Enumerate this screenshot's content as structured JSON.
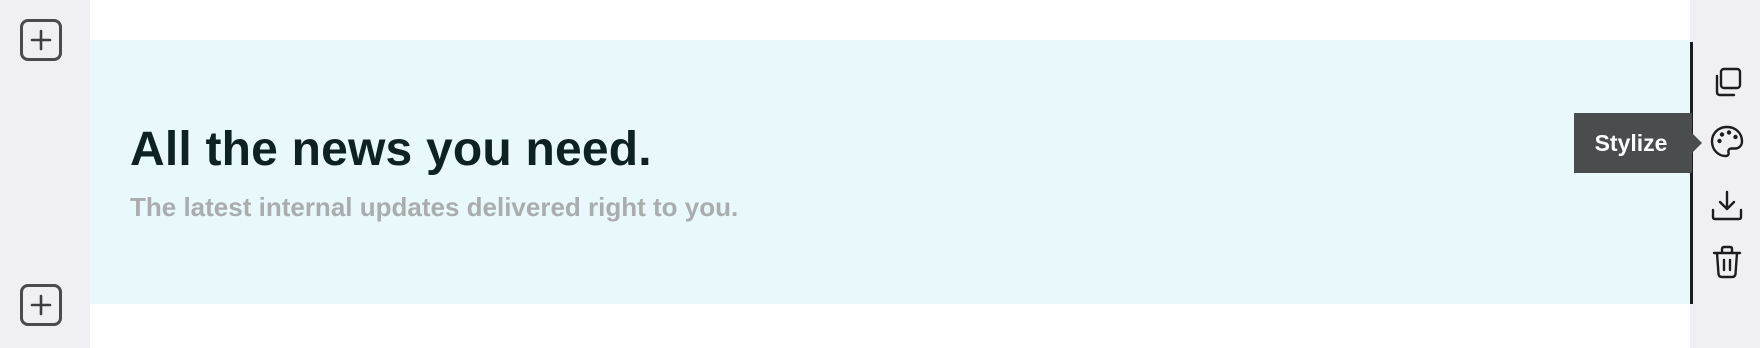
{
  "hero": {
    "heading": "All the news you need.",
    "subheading": "The latest internal updates delivered right to you.",
    "background_color": "#e8f8fb"
  },
  "block_toolbar": {
    "tooltip": "Stylize",
    "tools": [
      {
        "name": "duplicate",
        "icon": "duplicate-icon"
      },
      {
        "name": "stylize",
        "icon": "palette-icon"
      },
      {
        "name": "download",
        "icon": "download-icon"
      },
      {
        "name": "delete",
        "icon": "trash-icon"
      }
    ]
  },
  "add_buttons": [
    {
      "position": "above",
      "icon": "plus-icon"
    },
    {
      "position": "below",
      "icon": "plus-icon"
    }
  ]
}
